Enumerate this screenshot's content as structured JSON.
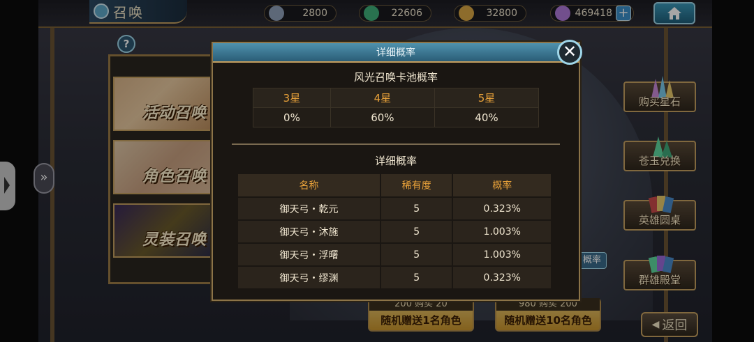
{
  "header": {
    "title": "召唤",
    "resources": [
      {
        "icon": "gear-currency-icon",
        "value": "2800",
        "color": "#8fa0b8"
      },
      {
        "icon": "feather-currency-icon",
        "value": "22606",
        "color": "#3fb07a"
      },
      {
        "icon": "coin-currency-icon",
        "value": "32800",
        "color": "#d9a744"
      },
      {
        "icon": "crystal-currency-icon",
        "value": "469418",
        "color": "#b07ad9"
      }
    ],
    "plus_label": "+",
    "home_icon": "home-icon"
  },
  "left_banners": [
    {
      "label": "活动召唤"
    },
    {
      "label": "角色召唤"
    },
    {
      "label": "灵装召唤"
    }
  ],
  "right_buttons": [
    {
      "label": "购买星石",
      "icon": "crystal-cluster-icon"
    },
    {
      "label": "苍玉兑换",
      "icon": "green-crystal-icon"
    },
    {
      "label": "英雄圆桌",
      "icon": "cards-icon"
    },
    {
      "label": "群雄殿堂",
      "icon": "cards-fan-icon"
    }
  ],
  "gacha_side_label": "概率",
  "bottom_buttons": [
    {
      "cost_left": "200",
      "cost_mid": "购买",
      "cost_right": "20",
      "label": "随机赠送1名角色"
    },
    {
      "cost_left": "980",
      "cost_mid": "购买",
      "cost_right": "200",
      "label": "随机赠送10名角色"
    }
  ],
  "back_label": "返回",
  "modal": {
    "title": "详细概率",
    "pool_title": "风光召唤卡池概率",
    "star_headers": [
      "3星",
      "4星",
      "5星"
    ],
    "star_values": [
      "0%",
      "60%",
      "40%"
    ],
    "detail_title": "详细概率",
    "detail_headers": [
      "名称",
      "稀有度",
      "概率"
    ],
    "detail_rows": [
      {
        "name": "御天弓・乾元",
        "rarity": "5",
        "rate": "0.323%"
      },
      {
        "name": "御天弓・沐施",
        "rarity": "5",
        "rate": "1.003%"
      },
      {
        "name": "御天弓・浮曙",
        "rarity": "5",
        "rate": "1.003%"
      },
      {
        "name": "御天弓・缪渊",
        "rarity": "5",
        "rate": "0.323%"
      }
    ],
    "close_label": "✕"
  }
}
